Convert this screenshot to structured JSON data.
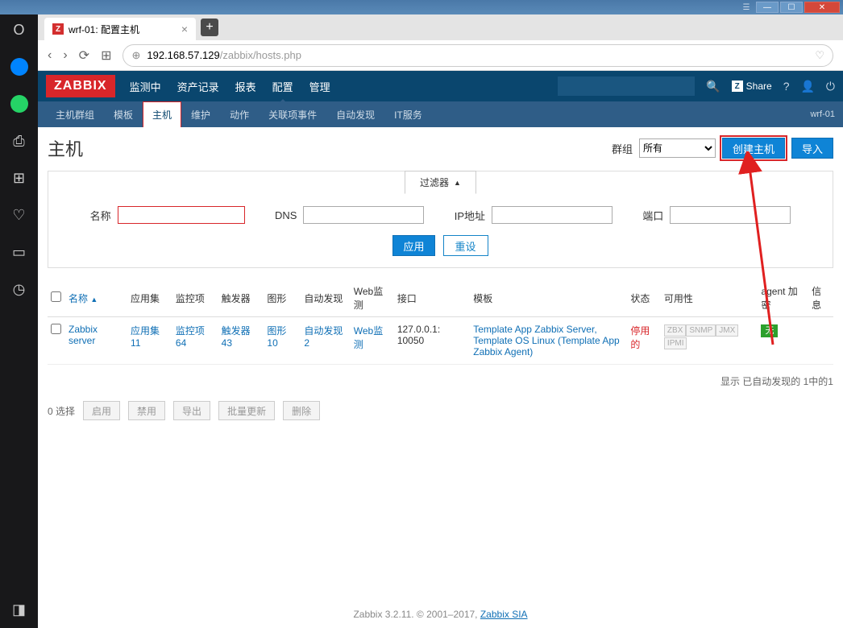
{
  "window": {
    "tab_title": "wrf-01: 配置主机"
  },
  "url": {
    "host": "192.168.57.129",
    "path": "/zabbix/hosts.php"
  },
  "zabbix": {
    "logo": "ZABBIX",
    "menu": [
      "监测中",
      "资产记录",
      "报表",
      "配置",
      "管理"
    ],
    "menu_active": "配置",
    "share": "Share",
    "submenu": [
      "主机群组",
      "模板",
      "主机",
      "维护",
      "动作",
      "关联项事件",
      "自动发现",
      "IT服务"
    ],
    "submenu_active": "主机",
    "sub_right": "wrf-01"
  },
  "page": {
    "title": "主机",
    "group_label": "群组",
    "group_value": "所有",
    "btn_create": "创建主机",
    "btn_import": "导入"
  },
  "filter": {
    "tab": "过滤器",
    "name_label": "名称",
    "dns_label": "DNS",
    "ip_label": "IP地址",
    "port_label": "端口",
    "apply": "应用",
    "reset": "重设"
  },
  "table": {
    "headers": {
      "name": "名称",
      "apps": "应用集",
      "items": "监控项",
      "triggers": "触发器",
      "graphs": "图形",
      "discovery": "自动发现",
      "web": "Web监测",
      "interface": "接口",
      "templates": "模板",
      "status": "状态",
      "availability": "可用性",
      "encryption": "agent 加密",
      "info": "信息"
    },
    "row": {
      "name": "Zabbix server",
      "apps": "应用集 11",
      "items": "监控项 64",
      "triggers": "触发器 43",
      "graphs": "图形 10",
      "discovery": "自动发现 2",
      "web": "Web监测",
      "interface": "127.0.0.1: 10050",
      "templates": "Template App Zabbix Server, Template OS Linux (Template App Zabbix Agent)",
      "status": "停用的",
      "avail": [
        "ZBX",
        "SNMP",
        "JMX",
        "IPMI"
      ],
      "encryption": "无"
    },
    "footer_info": "显示 已自动发现的 1中的1"
  },
  "bulk": {
    "selected": "0 选择",
    "enable": "启用",
    "disable": "禁用",
    "export": "导出",
    "massupdate": "批量更新",
    "delete": "删除"
  },
  "footer": {
    "text": "Zabbix 3.2.11. © 2001–2017, ",
    "link": "Zabbix SIA"
  }
}
